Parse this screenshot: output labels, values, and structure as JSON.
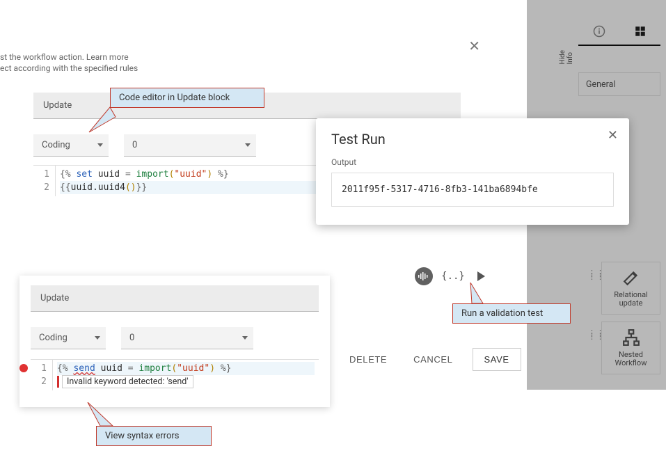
{
  "intro": {
    "line1_suffix": "st the workflow action. ",
    "learn": "Learn more",
    "line2": "ect according with the specified rules"
  },
  "upper": {
    "section": "Update",
    "mode": "Coding",
    "index": "0",
    "code": {
      "line1": {
        "open": "{% ",
        "kw": "set",
        "id": " uuid ",
        "eq": "=",
        "fn": " import",
        "lp": "(",
        "str": "\"uuid\"",
        "rp": ")",
        "close": " %}"
      },
      "line2": {
        "open": "{{",
        "expr": "uuid.uuid4",
        "lp": "(",
        "rp": ")",
        "close": "}}"
      }
    }
  },
  "lower": {
    "section": "Update",
    "mode": "Coding",
    "index": "0",
    "code": {
      "line1": {
        "open": "{% ",
        "kw": "send",
        "id": " uuid ",
        "eq": "=",
        "fn": " import",
        "lp": "(",
        "str": "\"uuid\"",
        "rp": ")",
        "close": " %}"
      },
      "error": "Invalid keyword detected: 'send'"
    }
  },
  "testrun": {
    "title": "Test Run",
    "output_label": "Output",
    "output_value": "2011f95f-5317-4716-8fb3-141ba6894bfe"
  },
  "actions": {
    "delete": "DELETE",
    "cancel": "CANCEL",
    "save": "SAVE"
  },
  "callouts": {
    "editor": "Code editor in Update block",
    "run": "Run a validation test",
    "syntax": "View syntax errors"
  },
  "side": {
    "general": "General",
    "hide": "Hide Info",
    "card_rel": "Relational update",
    "card_nest": "Nested Workflow"
  }
}
